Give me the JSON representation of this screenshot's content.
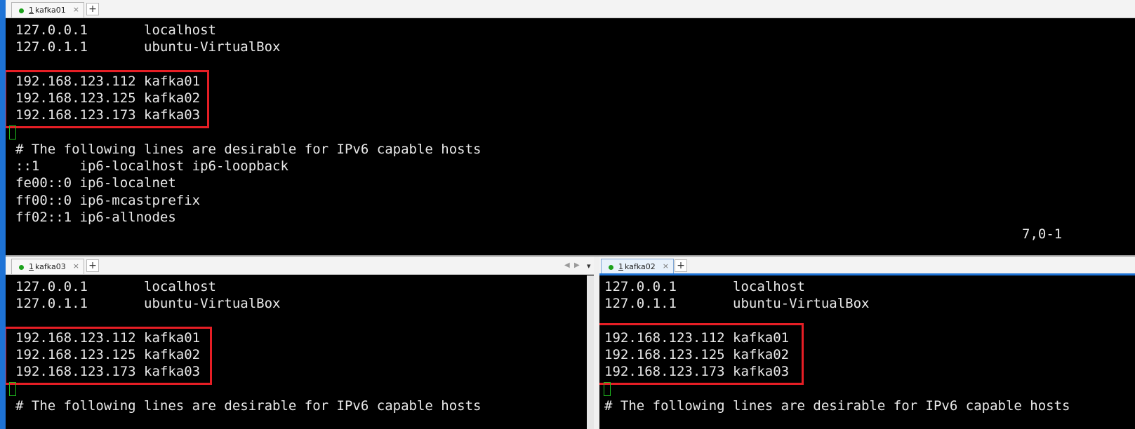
{
  "panes": {
    "top": {
      "tab": {
        "num": "1",
        "title": "kafka01",
        "close": "×"
      },
      "plus": "+",
      "lines": [
        "127.0.0.1       localhost",
        "127.0.1.1       ubuntu-VirtualBox",
        "",
        "192.168.123.112 kafka01",
        "192.168.123.125 kafka02",
        "192.168.123.173 kafka03",
        "",
        "# The following lines are desirable for IPv6 capable hosts",
        "::1     ip6-localhost ip6-loopback",
        "fe00::0 ip6-localnet",
        "ff00::0 ip6-mcastprefix",
        "ff02::1 ip6-allnodes"
      ],
      "status": "7,0-1"
    },
    "bottom_left": {
      "tab": {
        "num": "1",
        "title": "kafka03",
        "close": "×"
      },
      "plus": "+",
      "nav": {
        "left": "◀",
        "right": "▶",
        "menu": "▾"
      },
      "lines": [
        "127.0.0.1       localhost",
        "127.0.1.1       ubuntu-VirtualBox",
        "",
        "192.168.123.112 kafka01",
        "192.168.123.125 kafka02",
        "192.168.123.173 kafka03",
        "",
        "# The following lines are desirable for IPv6 capable hosts"
      ]
    },
    "bottom_right": {
      "tab": {
        "num": "1",
        "title": "kafka02",
        "close": "×"
      },
      "plus": "+",
      "lines": [
        "127.0.0.1       localhost",
        "127.0.1.1       ubuntu-VirtualBox",
        "",
        "192.168.123.112 kafka01",
        "192.168.123.125 kafka02",
        "192.168.123.173 kafka03",
        "",
        "# The following lines are desirable for IPv6 capable hosts"
      ]
    }
  },
  "colors": {
    "highlight": "#e61e25",
    "cursor": "#1fbf1f",
    "active_tab_accent": "#1e73d6"
  }
}
